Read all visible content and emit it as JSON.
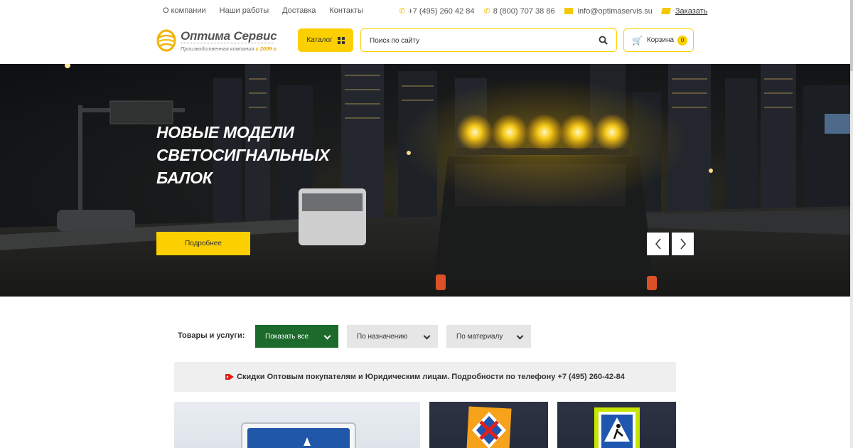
{
  "topbar": {
    "nav": [
      "О компании",
      "Наши работы",
      "Доставка",
      "Контакты"
    ],
    "phone1": "+7 (495) 260 42 84",
    "phone2": "8 (800) 707 38 86",
    "email": "info@optimaservis.su",
    "order_label": "Заказать"
  },
  "header": {
    "logo_title": "Оптима Сервис",
    "logo_subtitle": "Производственная компания",
    "logo_since": "с 2009 г.",
    "catalog_label": "Каталог",
    "search_placeholder": "Поиск по сайту",
    "cart_label": "Корзина",
    "cart_count": "0"
  },
  "hero": {
    "title": "Новые модели светосигнальных балок",
    "button_label": "Подробнее"
  },
  "filters": {
    "label": "Товары и услуги:",
    "options": [
      "Показать все",
      "По назначению",
      "По материалу"
    ]
  },
  "notice": {
    "text": "Скидки Оптовым покупателям и Юридическим лицам. Подробности по телефону +7 (495) 260-42-84"
  },
  "colors": {
    "accent": "#fccf00",
    "green": "#1c6a2c",
    "grey_button": "#e6e6e6",
    "notice_bg": "#efefef"
  },
  "icons": [
    "phone-icon",
    "mail-icon",
    "order-icon",
    "grid-icon",
    "search-icon",
    "cart-icon",
    "chevron-left-icon",
    "chevron-right-icon",
    "chevron-down-icon",
    "tag-icon"
  ]
}
